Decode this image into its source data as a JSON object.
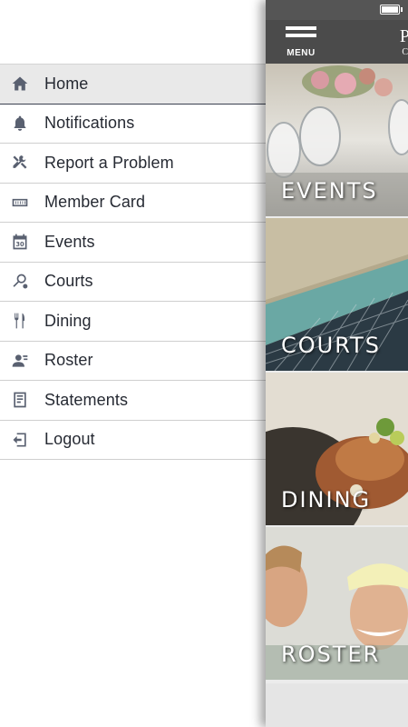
{
  "drawer": {
    "items": [
      {
        "label": "Home",
        "icon": "home-icon",
        "active": true
      },
      {
        "label": "Notifications",
        "icon": "bell-icon",
        "active": false
      },
      {
        "label": "Report a Problem",
        "icon": "tools-icon",
        "active": false
      },
      {
        "label": "Member Card",
        "icon": "member-card-icon",
        "active": false
      },
      {
        "label": "Events",
        "icon": "calendar-icon",
        "active": false
      },
      {
        "label": "Courts",
        "icon": "tennis-racket-icon",
        "active": false
      },
      {
        "label": "Dining",
        "icon": "utensils-icon",
        "active": false
      },
      {
        "label": "Roster",
        "icon": "roster-icon",
        "active": false
      },
      {
        "label": "Statements",
        "icon": "statement-icon",
        "active": false
      },
      {
        "label": "Logout",
        "icon": "logout-icon",
        "active": false
      }
    ]
  },
  "header": {
    "menu_label": "MENU",
    "logo_peek": "P",
    "logo_peek_sub": "C"
  },
  "tiles": {
    "events": "EVENTS",
    "courts": "COURTS",
    "dining": "DINING",
    "roster": "ROSTER"
  },
  "colors": {
    "header_bg": "#4b4b4b",
    "status_bar_bg": "#555555",
    "active_item_bg": "#e9e9e9",
    "icon_color": "#596070"
  }
}
